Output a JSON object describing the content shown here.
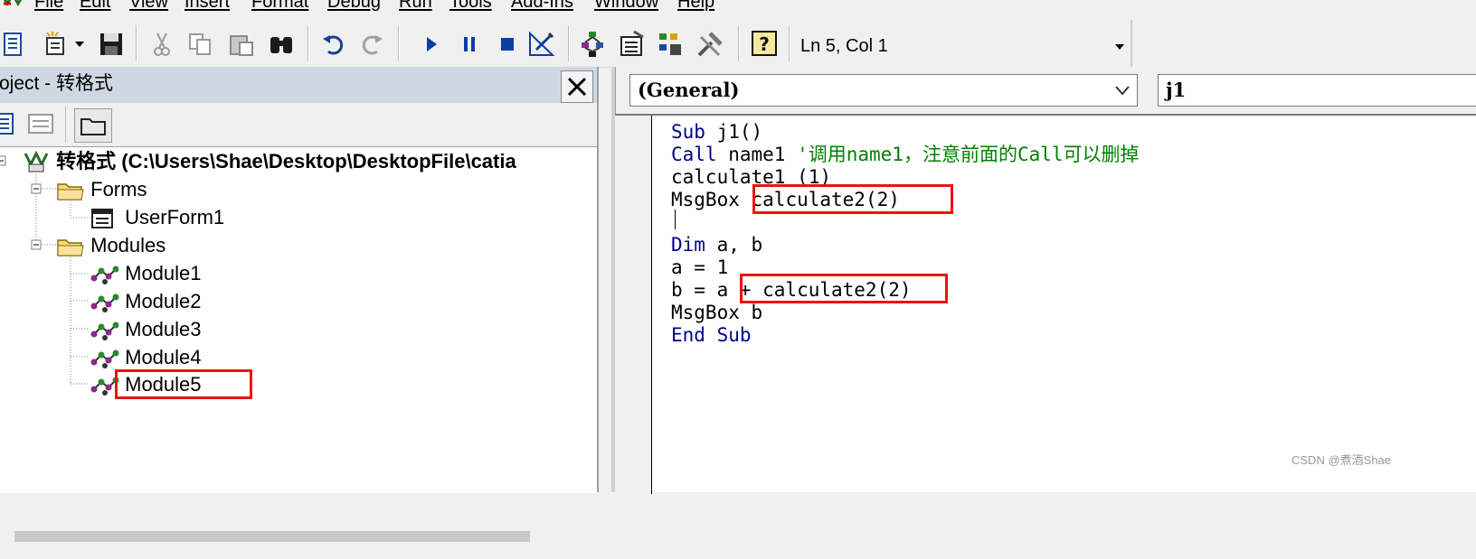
{
  "menu": {
    "items": [
      "File",
      "Edit",
      "View",
      "Insert",
      "Format",
      "Debug",
      "Run",
      "Tools",
      "Add-Ins",
      "Window",
      "Help"
    ]
  },
  "toolbar": {
    "icons": [
      "view-object-icon",
      "insert-userform-icon",
      "dropdown-arrow-icon",
      "save-icon",
      "cut-icon",
      "copy-icon",
      "paste-icon",
      "find-icon",
      "undo-icon",
      "redo-icon",
      "run-icon",
      "break-icon",
      "reset-icon",
      "design-mode-icon",
      "project-explorer-icon",
      "properties-window-icon",
      "object-browser-icon",
      "toolbox-icon",
      "help-icon"
    ],
    "position_text": "Ln 5, Col 1"
  },
  "project": {
    "title": "roject - 转格式",
    "tree": {
      "root": "转格式 (C:\\Users\\Shae\\Desktop\\DesktopFile\\catia",
      "forms_label": "Forms",
      "userform": "UserForm1",
      "modules_label": "Modules",
      "modules": [
        "Module1",
        "Module2",
        "Module3",
        "Module4",
        "Module5"
      ]
    }
  },
  "code": {
    "object_combo": "(General)",
    "proc_combo": "j1",
    "lines": {
      "l1_kw": "Sub",
      "l1_rest": " j1()",
      "l2_kw": "Call",
      "l2_rest": " name1 ",
      "l2_comment": "'调用name1，注意前面的Call可以删掉",
      "l3": "calculate1 (1)",
      "l4_pre": "MsgBox ",
      "l4_hl": "calculate2(2)",
      "l6_kw": "Dim",
      "l6_rest": " a, b",
      "l7": "a = 1",
      "l8_pre": "b = a ",
      "l8_hl": "+ calculate2(2)",
      "l9": "MsgBox b",
      "l10_kw1": "End",
      "l10_kw2": " Sub"
    }
  },
  "watermark": "CSDN @煮酒Shae"
}
